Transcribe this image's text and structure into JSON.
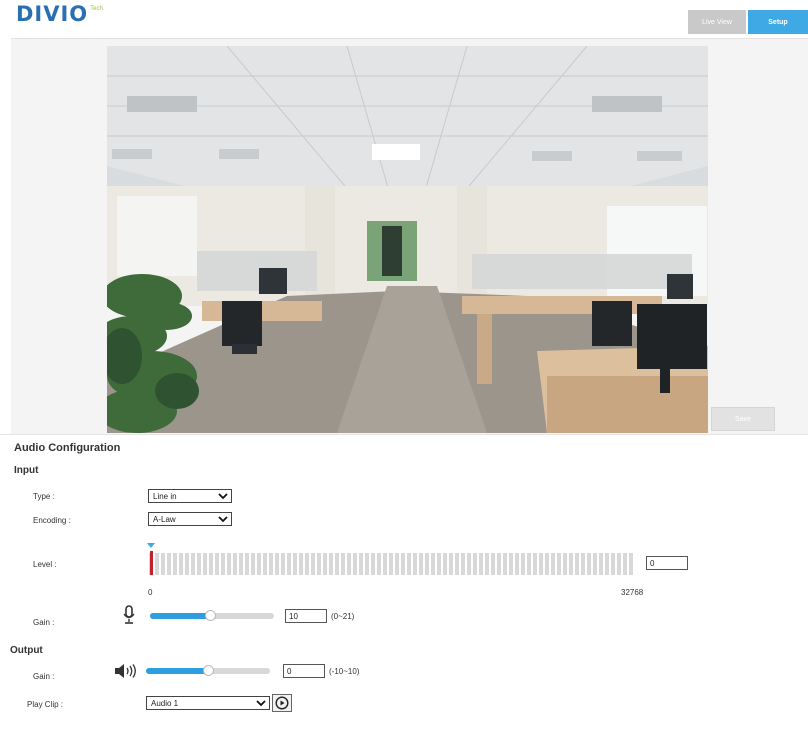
{
  "header": {
    "logo_text": "DIVIO",
    "logo_sub": "Tech",
    "live_view_label": "Live View",
    "setup_label": "Setup"
  },
  "preview": {
    "save_label": "Save"
  },
  "audio": {
    "title": "Audio Configuration",
    "input": {
      "title": "Input",
      "type_label": "Type :",
      "type_value": "Line in",
      "encoding_label": "Encoding :",
      "encoding_value": "A-Law",
      "level_label": "Level :",
      "level_value": "0",
      "level_min": "0",
      "level_max": "32768",
      "gain_label": "Gain :",
      "gain_value": "10",
      "gain_range": "(0~21)",
      "gain_fraction": 0.48
    },
    "output": {
      "title": "Output",
      "gain_label": "Gain :",
      "gain_value": "0",
      "gain_range": "(-10~10)",
      "gain_fraction": 0.5,
      "play_clip_label": "Play Clip :",
      "play_clip_value": "Audio 1"
    }
  },
  "colors": {
    "accent": "#3fa9e6",
    "slider_fill": "#2d9ee0",
    "level_marker": "#c0212b",
    "logo": "#2b6fb3"
  }
}
